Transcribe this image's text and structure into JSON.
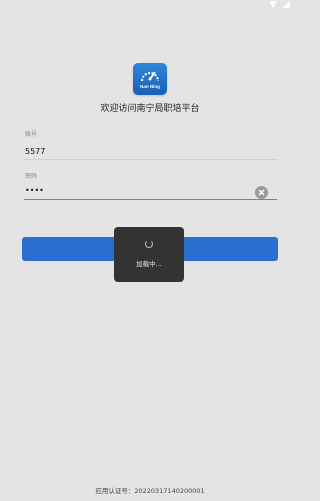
{
  "app": {
    "logo_text": "Nan Ning",
    "welcome": "欢迎访问南宁局职培平台"
  },
  "form": {
    "account": {
      "label": "账号",
      "value": "5577"
    },
    "password": {
      "label": "密码",
      "value": "••••"
    },
    "login_label": ""
  },
  "loading": {
    "text": "加载中..."
  },
  "footer": {
    "text": "应用认证号：20220317140200001"
  },
  "colors": {
    "background": "#e4e4e4",
    "primary": "#2a6fcf",
    "overlay": "#333333"
  }
}
